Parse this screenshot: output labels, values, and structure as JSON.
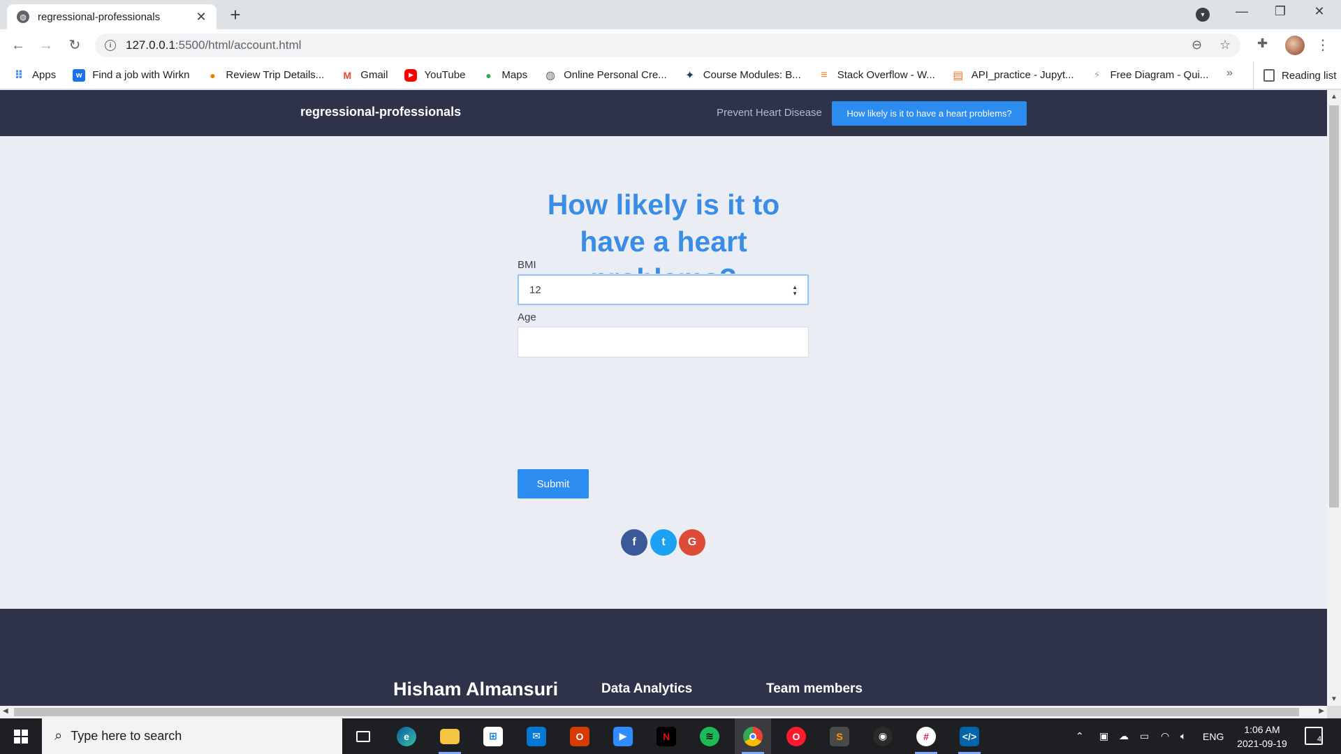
{
  "browser": {
    "tab_title": "regressional-professionals",
    "tab_close": "✕",
    "new_tab": "+",
    "url_host": "127.0.0.1",
    "url_path": ":5500/html/account.html",
    "win_min": "—",
    "win_restore": "❐",
    "win_close": "✕"
  },
  "bookmarks": [
    {
      "label": "Apps",
      "icon": "apps-grid-icon",
      "color": "#4285f4",
      "glyph": "⠿"
    },
    {
      "label": "Find a job with Wirkn",
      "icon": "wirkn-icon",
      "color": "#1a73e8",
      "glyph": "w"
    },
    {
      "label": "Review Trip Details...",
      "icon": "map-pin-icon",
      "color": "#f57c00",
      "glyph": "●"
    },
    {
      "label": "Gmail",
      "icon": "gmail-icon",
      "color": "#ea4335",
      "glyph": "M"
    },
    {
      "label": "YouTube",
      "icon": "youtube-icon",
      "color": "#ff0000",
      "glyph": "▶"
    },
    {
      "label": "Maps",
      "icon": "maps-icon",
      "color": "#34a853",
      "glyph": "●"
    },
    {
      "label": "Online Personal Cre...",
      "icon": "globe-icon",
      "color": "#5f6368",
      "glyph": "◍"
    },
    {
      "label": "Course Modules: B...",
      "icon": "course-icon",
      "color": "#1c3f6e",
      "glyph": "✦"
    },
    {
      "label": "Stack Overflow - W...",
      "icon": "stackoverflow-icon",
      "color": "#f48024",
      "glyph": "≡"
    },
    {
      "label": "API_practice - Jupyt...",
      "icon": "jupyter-icon",
      "color": "#f37626",
      "glyph": "▤"
    },
    {
      "label": "Free Diagram - Qui...",
      "icon": "diagram-icon",
      "color": "#9aa0a6",
      "glyph": "⚡"
    }
  ],
  "bookmarks_more": "»",
  "reading_list": "Reading list",
  "site": {
    "brand": "regressional-professionals",
    "nav_link": "Prevent Heart Disease",
    "nav_cta": "How likely is it to have a heart problems?",
    "heading": "How likely is it to have a heart problems?",
    "bmi_label": "BMI",
    "bmi_value": "12",
    "age_label": "Age",
    "age_value": "",
    "submit_label": "Submit",
    "social": [
      {
        "name": "facebook",
        "glyph": "f",
        "color": "#3b5998"
      },
      {
        "name": "twitter",
        "glyph": "t",
        "color": "#1da1f2"
      },
      {
        "name": "google",
        "glyph": "G",
        "color": "#dd4b39"
      }
    ],
    "footer": {
      "name": "Hisham Almansuri",
      "col2": "Data Analytics",
      "col3": "Team members"
    }
  },
  "taskbar": {
    "search_placeholder": "Type here to search",
    "language": "ENG",
    "time": "1:06 AM",
    "date": "2021-09-19",
    "notifications": "4"
  }
}
